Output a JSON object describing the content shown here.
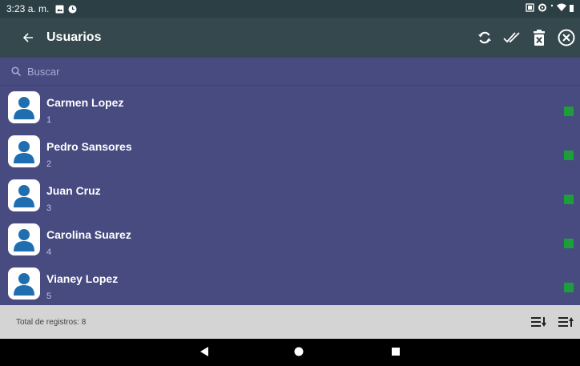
{
  "status_bar": {
    "time": "3:23 a. m."
  },
  "app_bar": {
    "title": "Usuarios"
  },
  "search": {
    "placeholder": "Buscar"
  },
  "users": [
    {
      "name": "Carmen Lopez",
      "id": "1"
    },
    {
      "name": "Pedro Sansores",
      "id": "2"
    },
    {
      "name": "Juan Cruz",
      "id": "3"
    },
    {
      "name": "Carolina Suarez",
      "id": "4"
    },
    {
      "name": "Vianey Lopez",
      "id": "5"
    }
  ],
  "footer": {
    "total_label": "Total de registros: 8"
  },
  "colors": {
    "app_bar": "#34484e",
    "list_bg": "#474b80",
    "status_active": "#1e9e3a",
    "avatar": "#1f6fb0"
  }
}
